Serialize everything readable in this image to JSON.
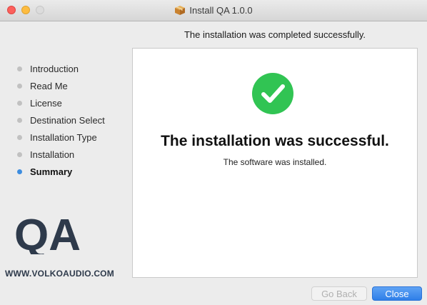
{
  "window": {
    "title": "Install QA 1.0.0"
  },
  "header": {
    "status": "The installation was completed successfully."
  },
  "sidebar": {
    "steps": [
      {
        "label": "Introduction"
      },
      {
        "label": "Read Me"
      },
      {
        "label": "License"
      },
      {
        "label": "Destination Select"
      },
      {
        "label": "Installation Type"
      },
      {
        "label": "Installation"
      },
      {
        "label": "Summary",
        "active": true
      }
    ],
    "logo_text": "QA",
    "logo_url": "WWW.VOLKOAUDIO.COM"
  },
  "main": {
    "title": "The installation was successful.",
    "subtitle": "The software was installed."
  },
  "buttons": {
    "back": "Go Back",
    "close": "Close"
  },
  "colors": {
    "success_green": "#31c453",
    "accent_blue": "#3d8ddf"
  }
}
